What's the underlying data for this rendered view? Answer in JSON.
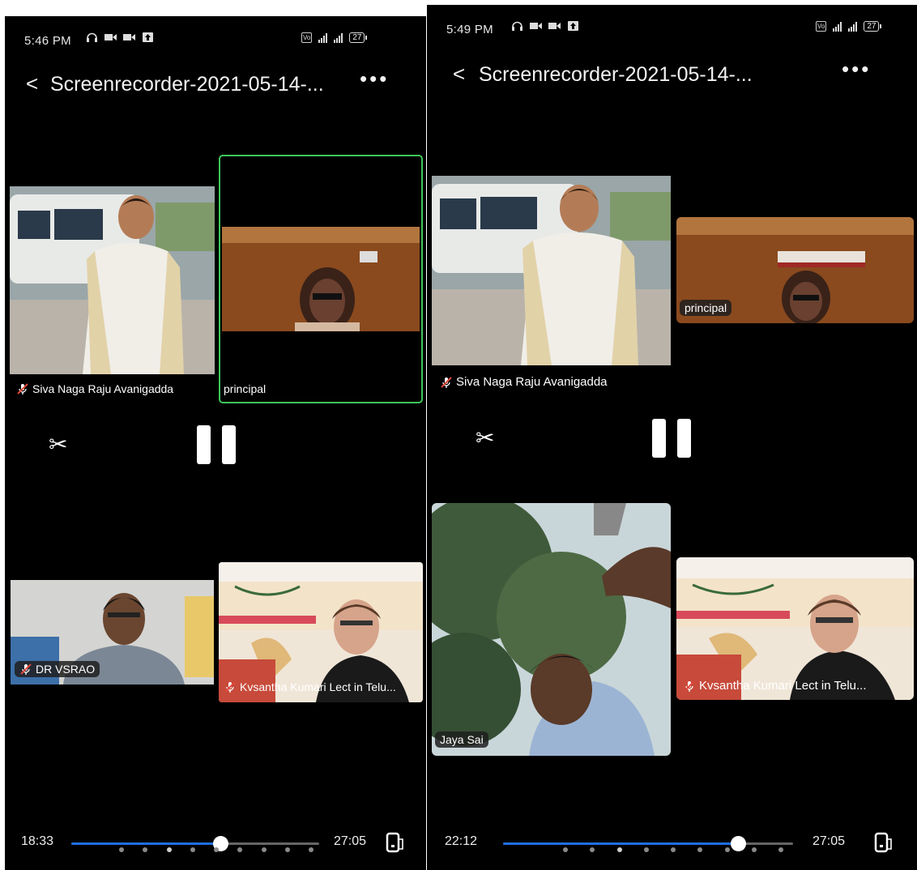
{
  "left": {
    "status": {
      "time": "5:46 PM",
      "battery": "27",
      "network": "4G"
    },
    "title": "Screenrecorder-2021-05-14-...",
    "participants": {
      "p1": "Siva Naga Raju Avanigadda",
      "p2": "principal",
      "p3": "DR VSRAO",
      "p4": "Kvsantha Kumari Lect in Telu..."
    },
    "player": {
      "current": "18:33",
      "duration": "27:05",
      "progress": 0.6
    }
  },
  "right": {
    "status": {
      "time": "5:49 PM",
      "battery": "27",
      "network": "4G"
    },
    "title": "Screenrecorder-2021-05-14-...",
    "participants": {
      "p1": "Siva Naga Raju Avanigadda",
      "p2": "principal",
      "p3": "Jaya Sai",
      "p4": "Kvsantha Kumari Lect in Telu..."
    },
    "player": {
      "current": "22:12",
      "duration": "27:05",
      "progress": 0.81
    }
  },
  "icons": {
    "back": "chevron-left-icon",
    "more": "more-horizontal-icon",
    "mic_muted": "mic-muted-icon",
    "trim": "scissors-icon",
    "pause": "pause-icon",
    "rotate": "rotate-screen-icon"
  },
  "colors": {
    "active_speaker_border": "#3ec65a",
    "progress_fill": "#1f6fe0",
    "muted_mic": "#e0463a"
  }
}
